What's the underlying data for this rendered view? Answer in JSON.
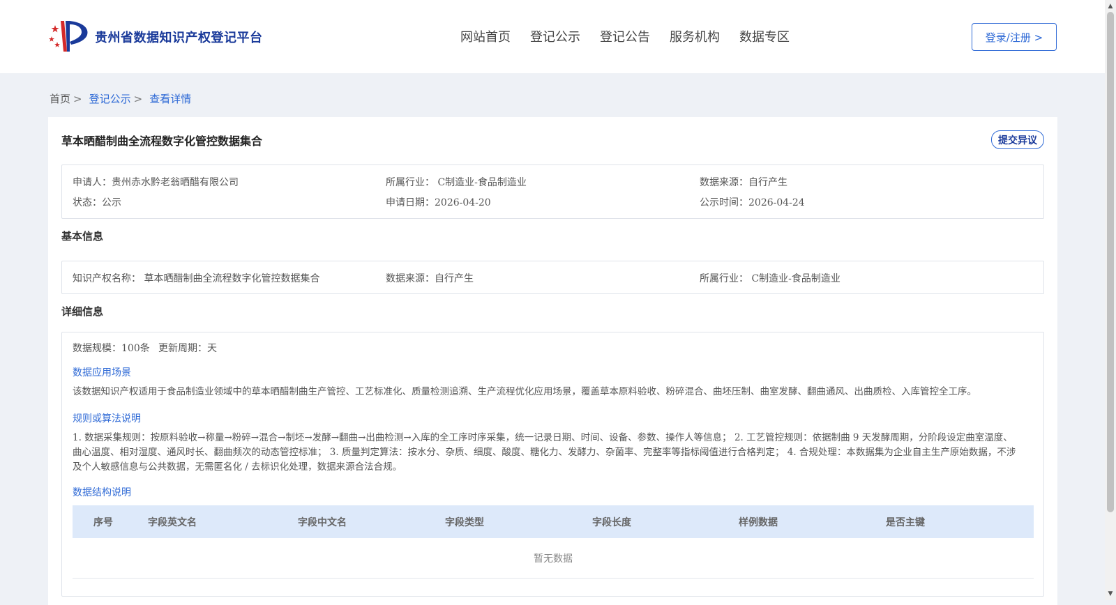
{
  "header": {
    "site_name": "贵州省数据知识产权登记平台",
    "nav": [
      "网站首页",
      "登记公示",
      "登记公告",
      "服务机构",
      "数据专区"
    ],
    "login_label": "登录/注册 >"
  },
  "breadcrumb": {
    "home": "首页",
    "registration": "登记公示",
    "current": "查看详情",
    "separator": ">"
  },
  "record": {
    "title": "草本晒醋制曲全流程数字化管控数据集合",
    "objection_label": "提交异议",
    "summary": {
      "applicant": "申请人：贵州赤水黔老翁晒醋有限公司",
      "industry": "所属行业： C制造业-食品制造业",
      "data_source": "数据来源：自行产生",
      "status": "状态：公示",
      "apply_date": "申请日期：2026-04-20",
      "publish_date": "公示时间：2026-04-24"
    }
  },
  "basic_info": {
    "heading": "基本信息",
    "ip_name": "知识产权名称： 草本晒醋制曲全流程数字化管控数据集合",
    "data_source": "数据来源：自行产生",
    "industry": "所属行业： C制造业-食品制造业"
  },
  "detail_info": {
    "heading": "详细信息",
    "scale": "数据规模：100条",
    "update_cycle": "更新周期：天",
    "scenario_title": "数据应用场景",
    "scenario_text": "该数据知识产权适用于食品制造业领域中的草本晒醋制曲生产管控、工艺标准化、质量检测追溯、生产流程优化应用场景，覆盖草本原料验收、粉碎混合、曲坯压制、曲室发酵、翻曲通风、出曲质检、入库管控全工序。",
    "rules_title": "规则或算法说明",
    "rules_text": "1. 数据采集规则：按原料验收→称量→粉碎→混合→制坯→发酵→翻曲→出曲检测→入库的全工序时序采集，统一记录日期、时间、设备、参数、操作人等信息； 2. 工艺管控规则：依据制曲 9 天发酵周期，分阶段设定曲室温度、曲心温度、相对湿度、通风时长、翻曲频次的动态管控标准； 3. 质量判定算法：按水分、杂质、细度、酸度、糖化力、发酵力、杂菌率、完整率等指标阈值进行合格判定； 4. 合规处理：本数据集为企业自主生产原始数据，不涉及个人敏感信息与公共数据，无需匿名化 / 去标识化处理，数据来源合法合规。",
    "structure_title": "数据结构说明",
    "table_headers": [
      "序号",
      "字段英文名",
      "字段中文名",
      "字段类型",
      "字段长度",
      "样例数据",
      "是否主键"
    ],
    "empty_text": "暂无数据"
  },
  "colors": {
    "accent": "#2f6ad6",
    "brand": "#1a3a9a",
    "table_header_bg": "#dde9fa",
    "page_bg": "#eef1f6"
  }
}
